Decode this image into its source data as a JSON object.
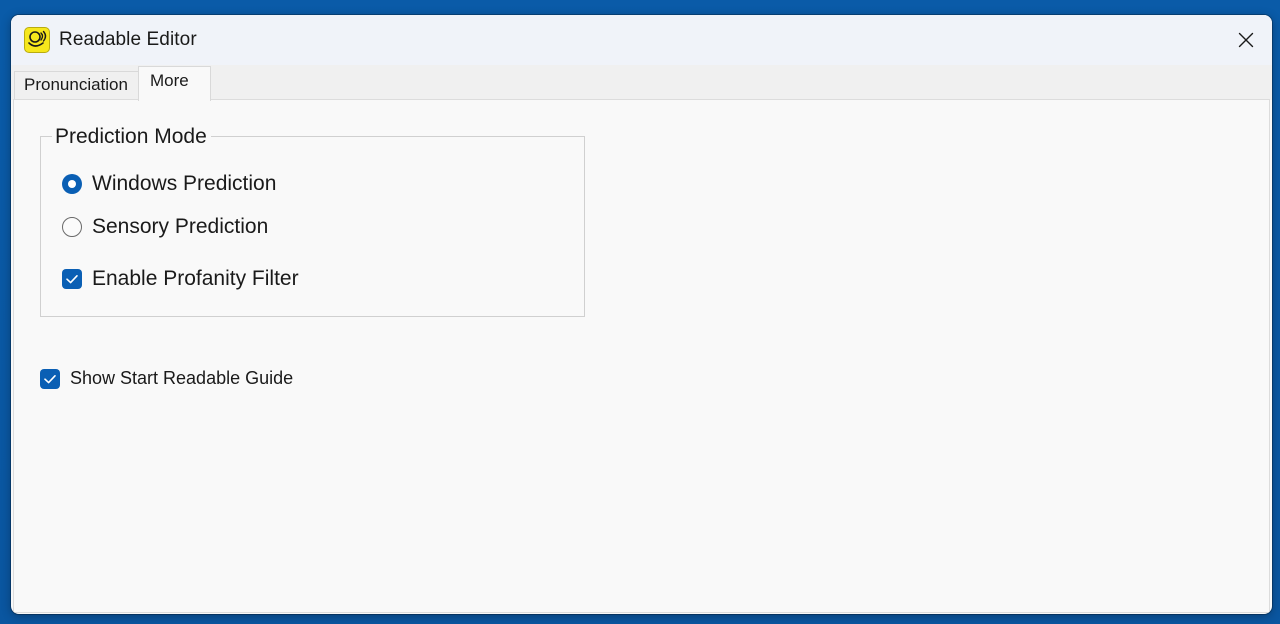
{
  "window": {
    "title": "Readable Editor",
    "app_icon": "readable-app-icon",
    "close_icon": "close-icon"
  },
  "tabs": [
    {
      "label": "Pronunciation",
      "selected": false
    },
    {
      "label": "More",
      "selected": true
    }
  ],
  "prediction_group": {
    "legend": "Prediction Mode",
    "options": [
      {
        "label": "Windows Prediction",
        "checked": true
      },
      {
        "label": "Sensory Prediction",
        "checked": false
      }
    ],
    "profanity_filter": {
      "label": "Enable Profanity Filter",
      "checked": true
    }
  },
  "start_guide": {
    "label": "Show Start Readable Guide",
    "checked": true
  },
  "colors": {
    "accent": "#0a5fb4",
    "desktop": "#0a5ba8",
    "app_icon_bg": "#f6e71c"
  }
}
